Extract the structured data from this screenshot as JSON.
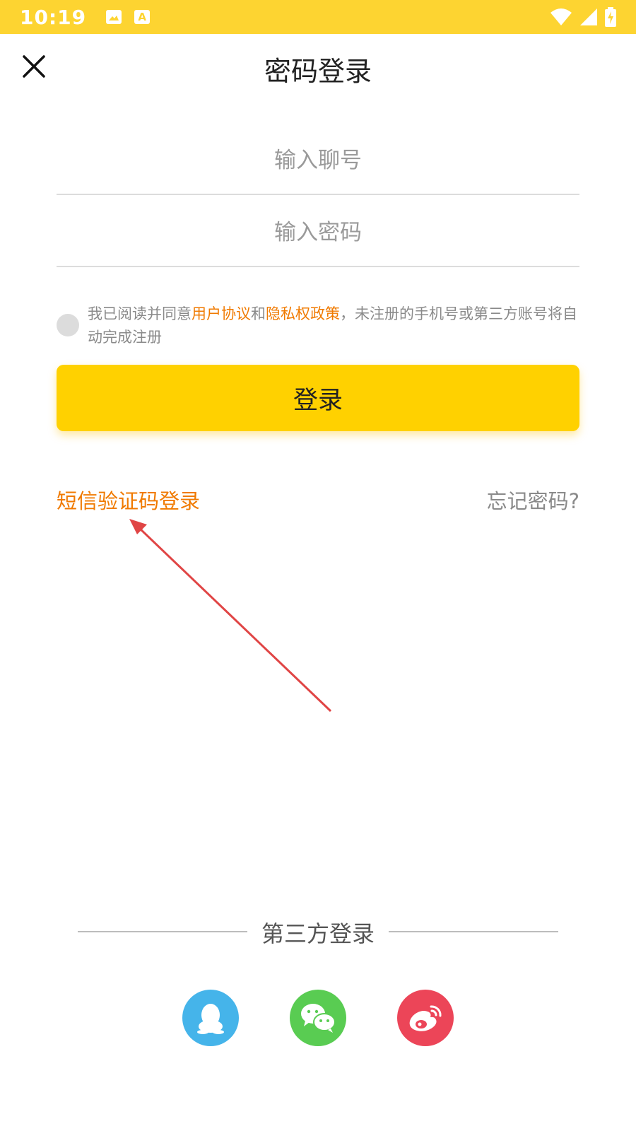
{
  "status_bar": {
    "time": "10:19",
    "icons": [
      "image-icon",
      "text-icon",
      "wifi-icon",
      "signal-icon",
      "battery-icon"
    ],
    "text_icon_letter": "A"
  },
  "header": {
    "title": "密码登录",
    "close_icon": "close-icon"
  },
  "form": {
    "account_placeholder": "输入聊号",
    "password_placeholder": "输入密码"
  },
  "agreement": {
    "prefix": "我已阅读并同意",
    "user_agreement": "用户协议",
    "and": "和",
    "privacy_policy": "隐私权政策",
    "suffix": "，未注册的手机号或第三方账号将自动完成注册"
  },
  "login_button": "登录",
  "links": {
    "sms_login": "短信验证码登录",
    "forgot_password": "忘记密码?"
  },
  "third_party": {
    "title": "第三方登录",
    "providers": [
      "qq-icon",
      "wechat-icon",
      "weibo-icon"
    ]
  },
  "colors": {
    "brand_yellow": "#ffd100",
    "status_bar": "#fdd431",
    "link_orange": "#f07a00",
    "qq": "#45b4ea",
    "wechat": "#59cc52",
    "weibo": "#ec4558",
    "annotation_arrow": "#e04545"
  }
}
